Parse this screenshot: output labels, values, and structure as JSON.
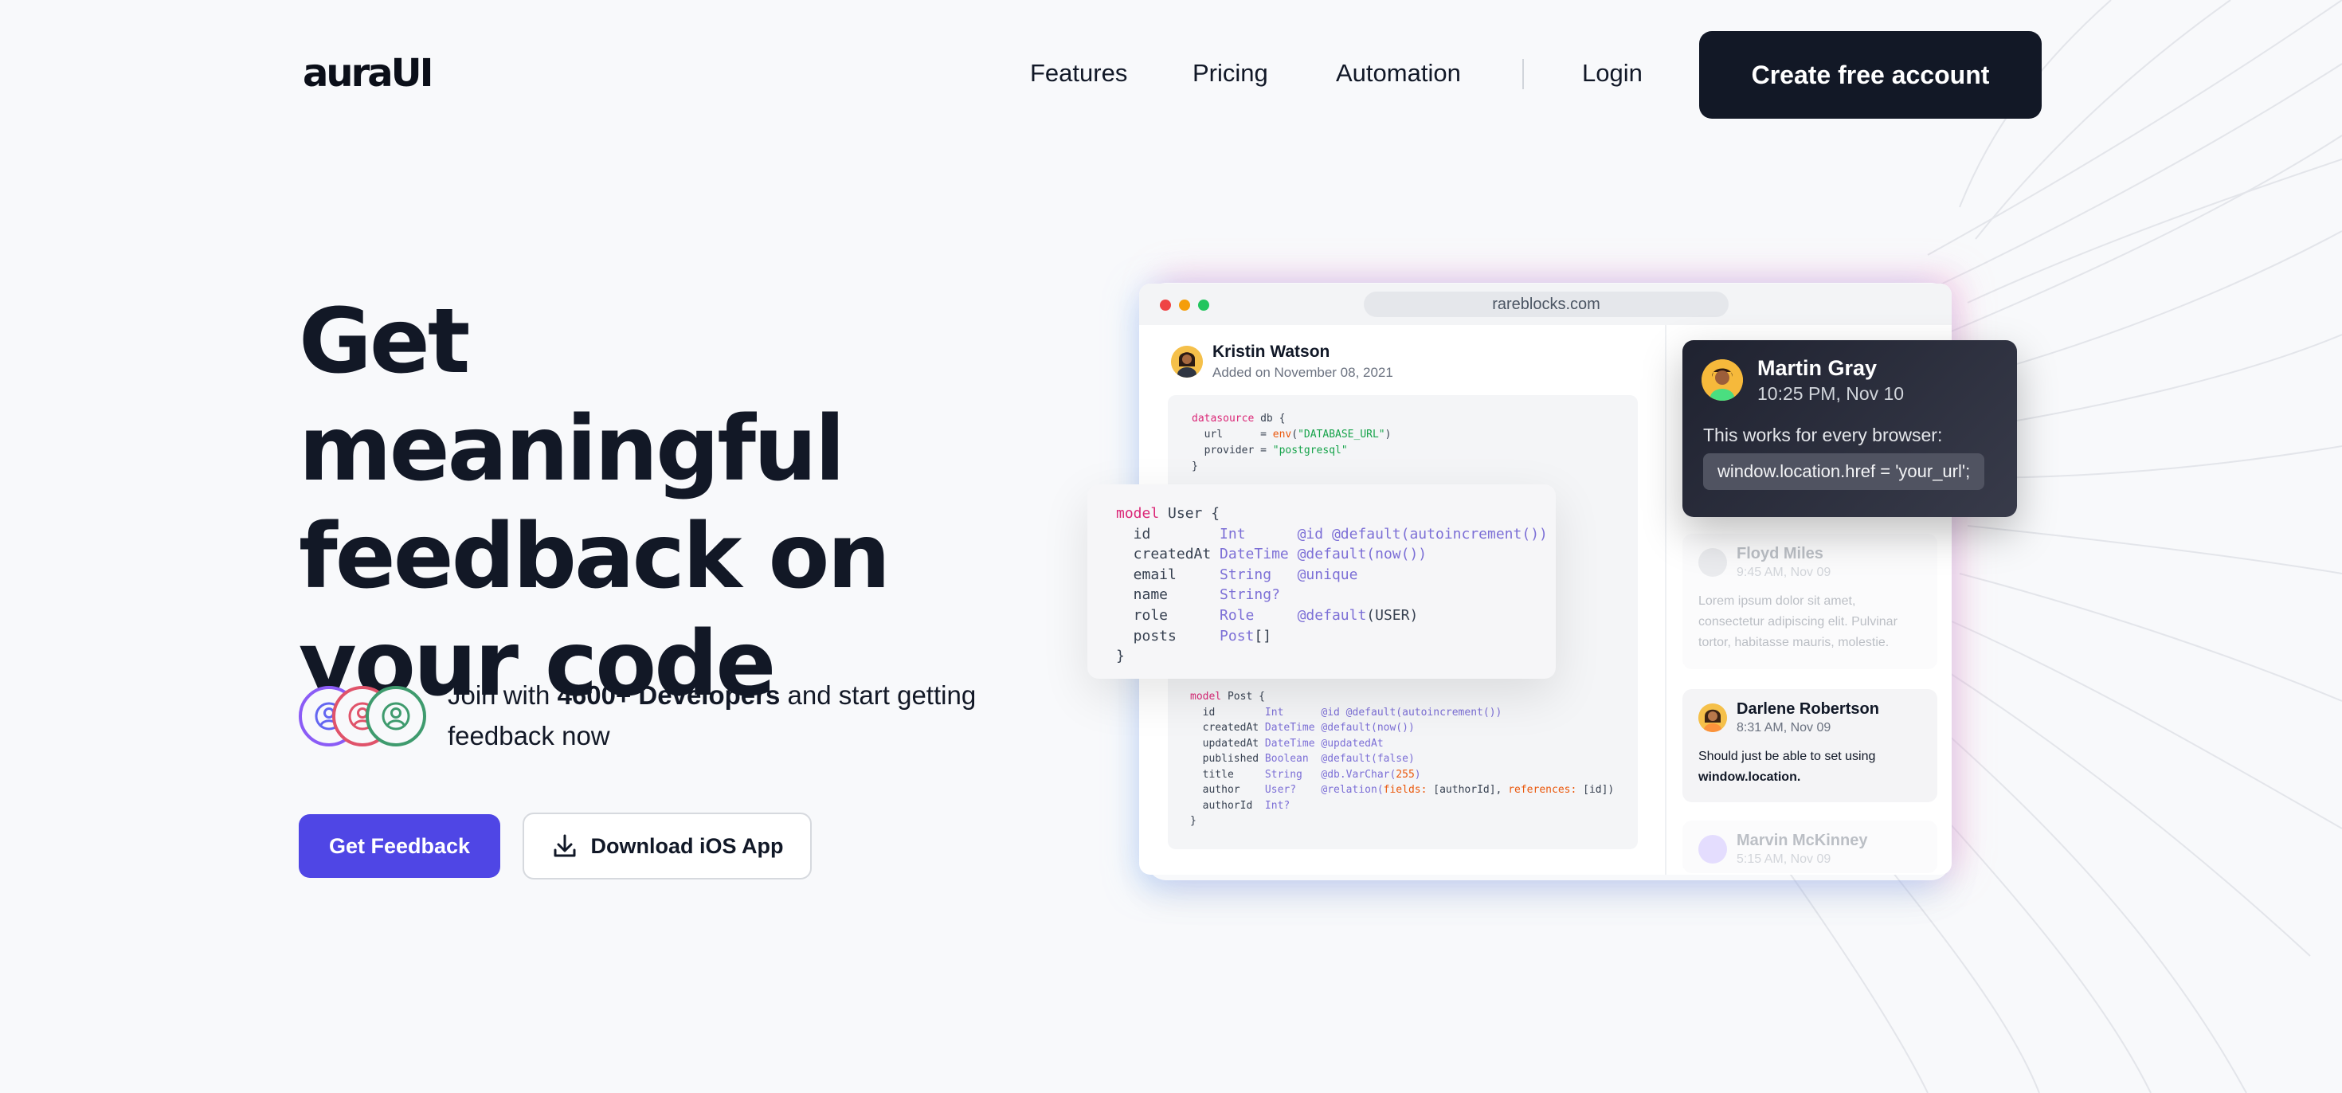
{
  "nav": {
    "logo": "auraUI",
    "links": [
      "Features",
      "Pricing",
      "Automation"
    ],
    "login": "Login",
    "cta": "Create free account"
  },
  "hero": {
    "title_lines": [
      "Get meaningful",
      "feedback on",
      "your code"
    ],
    "join_prefix": "Join with ",
    "join_bold": "4600+ Developers",
    "join_suffix": " and start getting feedback now",
    "primary_button": "Get Feedback",
    "secondary_button": "Download iOS App"
  },
  "mockup": {
    "url": "rareblocks.com",
    "author_name": "Kristin Watson",
    "author_sub": "Added on November 08, 2021",
    "comments": [
      {
        "name": "Martin Gray",
        "time": "10:25 PM, Nov 10",
        "text": "This works for every browser:",
        "code": "window.location.href = 'your_url';"
      },
      {
        "name": "Floyd Miles",
        "time": "9:45 AM, Nov 09",
        "text": "Lorem ipsum dolor sit amet, consectetur adipiscing elit. Pulvinar tortor, habitasse mauris, molestie."
      },
      {
        "name": "Darlene Robertson",
        "time": "8:31 AM, Nov 09",
        "text": "Should just be able to set using",
        "text_bold": "window.location."
      },
      {
        "name": "Marvin McKinney",
        "time": "5:15 AM, Nov 09"
      }
    ]
  },
  "colors": {
    "primary": "#4f46e5",
    "dark": "#121826",
    "background": "#f8f9fb"
  }
}
